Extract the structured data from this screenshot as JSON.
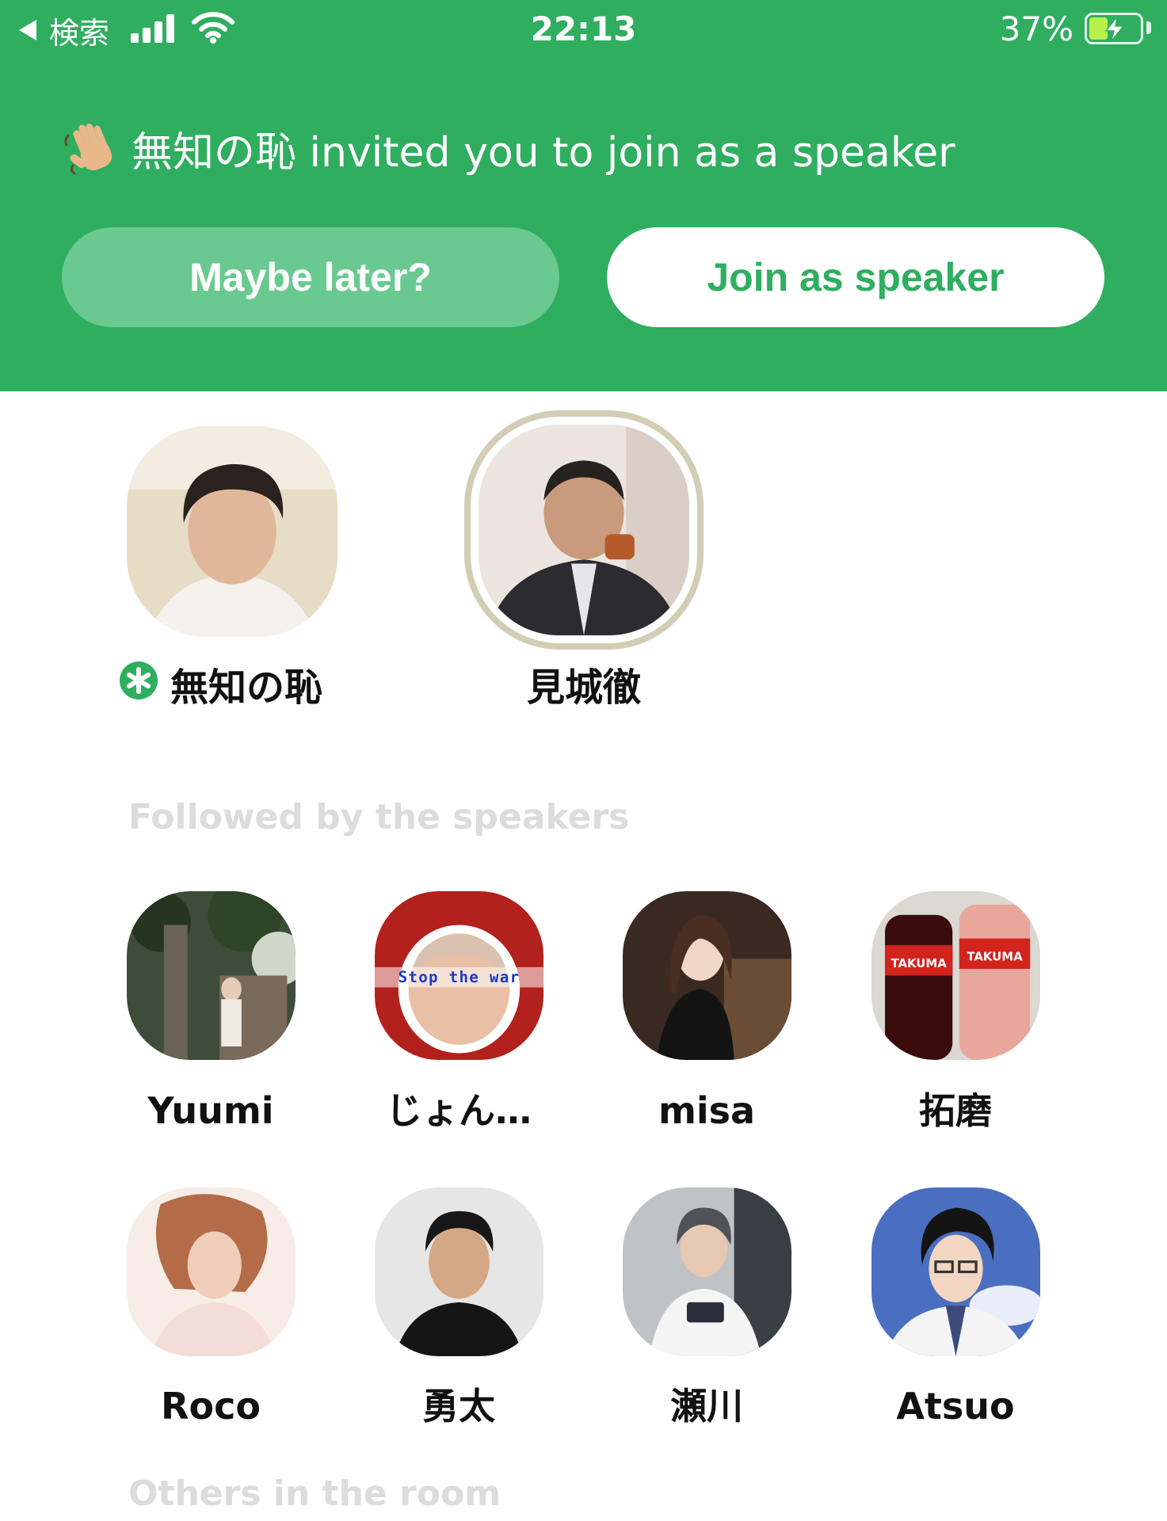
{
  "status_bar": {
    "back_label": "検索",
    "time": "22:13",
    "battery_percent": "37%",
    "battery_level": 0.37,
    "icons": [
      "back-arrow-icon",
      "cellular-signal-icon",
      "wifi-icon",
      "battery-charging-icon"
    ]
  },
  "invite": {
    "emoji": "waving-hand-icon",
    "message": "無知の恥 invited you to join as a speaker",
    "maybe_label": "Maybe later?",
    "join_label": "Join as speaker"
  },
  "speakers": [
    {
      "name": "無知の恥",
      "moderator": true,
      "icon": "moderator-badge-icon"
    },
    {
      "name": "見城徹",
      "moderator": false
    }
  ],
  "followed_section": {
    "title": "Followed by the speakers",
    "users": [
      {
        "name": "Yuumi"
      },
      {
        "name": "じょん…",
        "avatar_text": "Stop the war"
      },
      {
        "name": "misa"
      },
      {
        "name": "拓磨",
        "avatar_text": "TAKUMA"
      },
      {
        "name": "Roco"
      },
      {
        "name": "勇太"
      },
      {
        "name": "瀬川"
      },
      {
        "name": "Atsuo"
      }
    ]
  },
  "others_section": {
    "title": "Others in the room"
  },
  "colors": {
    "accent_green": "#2fae60",
    "maybe_button": "#6ac990",
    "moderator_ring": "#d2cdb4",
    "section_label": "#dcdcdc"
  }
}
